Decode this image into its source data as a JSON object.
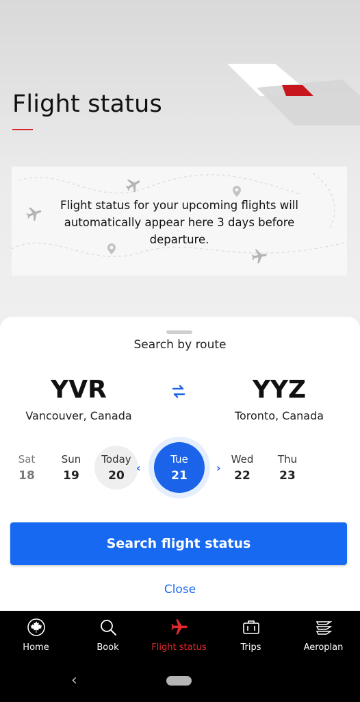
{
  "header": {
    "title": "Flight status"
  },
  "info": {
    "message": "Flight status for your upcoming flights will automatically appear here 3 days before departure."
  },
  "sheet": {
    "heading": "Search by route",
    "origin": {
      "code": "YVR",
      "city": "Vancouver, Canada"
    },
    "destination": {
      "code": "YYZ",
      "city": "Toronto, Canada"
    },
    "swap_icon": "swap-arrows-icon",
    "dates": [
      {
        "name": "Sat",
        "day": "18",
        "state": "past"
      },
      {
        "name": "Sun",
        "day": "19",
        "state": "normal"
      },
      {
        "name": "Today",
        "day": "20",
        "state": "today"
      },
      {
        "name": "Tue",
        "day": "21",
        "state": "selected"
      },
      {
        "name": "Wed",
        "day": "22",
        "state": "normal"
      },
      {
        "name": "Thu",
        "day": "23",
        "state": "normal"
      }
    ],
    "prev_icon": "chevron-left-icon",
    "next_icon": "chevron-right-icon",
    "search_label": "Search flight status",
    "close_label": "Close"
  },
  "tabs": [
    {
      "label": "Home",
      "icon": "maple-leaf-icon",
      "active": false
    },
    {
      "label": "Book",
      "icon": "search-icon",
      "active": false
    },
    {
      "label": "Flight status",
      "icon": "airplane-icon",
      "active": true
    },
    {
      "label": "Trips",
      "icon": "suitcase-icon",
      "active": false
    },
    {
      "label": "Aeroplan",
      "icon": "aeroplan-icon",
      "active": false
    }
  ],
  "colors": {
    "accent_blue": "#1669f0",
    "brand_red": "#d8232a",
    "tab_bar": "#000000"
  }
}
